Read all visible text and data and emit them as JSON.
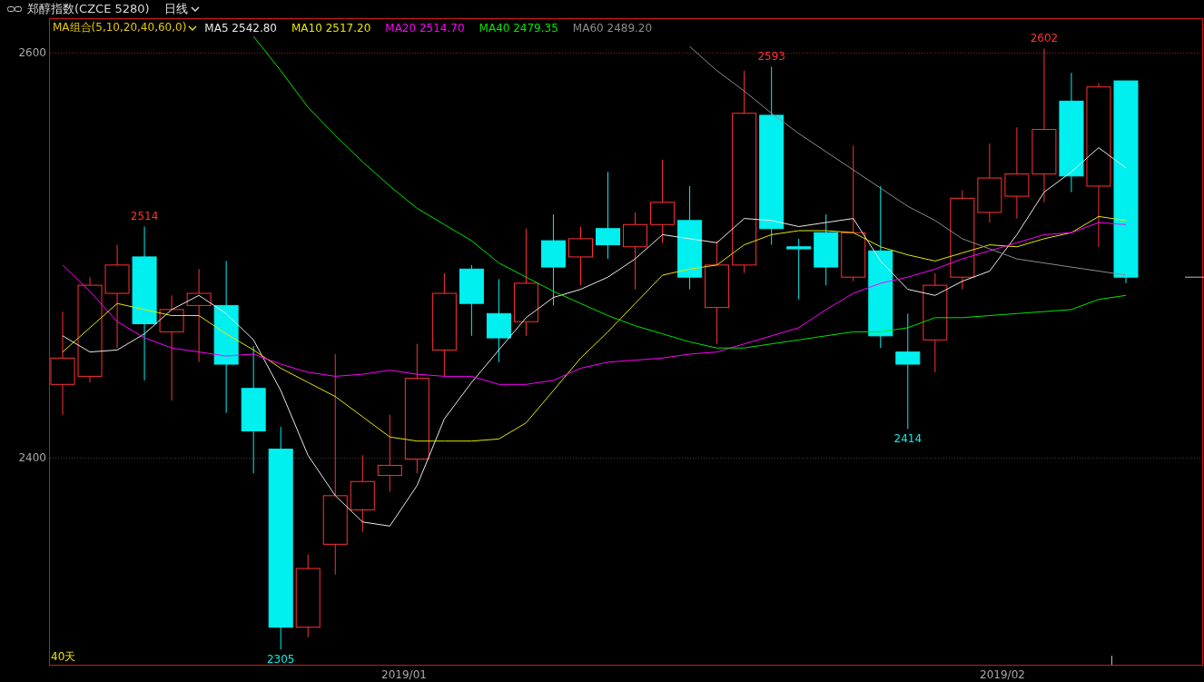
{
  "header": {
    "title": "郑醇指数(CZCE 5280)",
    "period": "日线"
  },
  "indicator_bar": {
    "preset": "MA组合(5,10,20,40,60,0)",
    "values": [
      "2542.80",
      "2517.20",
      "2514.70",
      "2479.35",
      "2489.20"
    ]
  },
  "period_label": "40天",
  "price_labels": [
    {
      "text": "2514",
      "kind": "high"
    },
    {
      "text": "2305",
      "kind": "low"
    },
    {
      "text": "2593",
      "kind": "high"
    },
    {
      "text": "2414",
      "kind": "low"
    },
    {
      "text": "2602",
      "kind": "high"
    }
  ],
  "x_axis_labels": [
    "2019/01",
    "2019/02"
  ],
  "chart": {
    "chart_data": {
      "type": "candlestick",
      "ylim": [
        2297,
        2617
      ],
      "yticks": [
        2400,
        2600
      ],
      "ref_lines": [
        {
          "axis": "y",
          "value": 2600,
          "color": "#b01010"
        },
        {
          "axis": "y",
          "value": 2400,
          "color": "#3a3a3a"
        }
      ],
      "ohlc": [
        [
          2436,
          2472,
          2421,
          2449
        ],
        [
          2440,
          2489,
          2437,
          2485
        ],
        [
          2481,
          2505,
          2454,
          2495
        ],
        [
          2499,
          2514,
          2438,
          2466
        ],
        [
          2462,
          2480,
          2428,
          2473
        ],
        [
          2475,
          2493,
          2447,
          2481
        ],
        [
          2475,
          2497,
          2422,
          2446
        ],
        [
          2434,
          2455,
          2392,
          2413
        ],
        [
          2404,
          2415,
          2305,
          2316
        ],
        [
          2316,
          2352,
          2311,
          2345
        ],
        [
          2357,
          2451,
          2342,
          2381
        ],
        [
          2374,
          2401,
          2363,
          2388
        ],
        [
          2391,
          2421,
          2383,
          2396
        ],
        [
          2399,
          2456,
          2392,
          2439
        ],
        [
          2453,
          2491,
          2440,
          2481
        ],
        [
          2493,
          2495,
          2460,
          2476
        ],
        [
          2471,
          2488,
          2447,
          2459
        ],
        [
          2467,
          2513,
          2460,
          2486
        ],
        [
          2507,
          2520,
          2475,
          2494
        ],
        [
          2499,
          2514,
          2485,
          2508
        ],
        [
          2513,
          2541,
          2498,
          2505
        ],
        [
          2504,
          2521,
          2483,
          2515
        ],
        [
          2515,
          2547,
          2506,
          2526
        ],
        [
          2517,
          2534,
          2483,
          2489
        ],
        [
          2474,
          2507,
          2456,
          2495
        ],
        [
          2495,
          2591,
          2491,
          2570
        ],
        [
          2569,
          2593,
          2505,
          2513
        ],
        [
          2504,
          2508,
          2478,
          2503
        ],
        [
          2511,
          2520,
          2485,
          2494
        ],
        [
          2489,
          2554,
          2487,
          2511
        ],
        [
          2502,
          2534,
          2454,
          2460
        ],
        [
          2452,
          2471,
          2414,
          2446
        ],
        [
          2458,
          2491,
          2442,
          2485
        ],
        [
          2489,
          2532,
          2483,
          2528
        ],
        [
          2521,
          2555,
          2516,
          2538
        ],
        [
          2529,
          2563,
          2518,
          2540
        ],
        [
          2540,
          2602,
          2526,
          2562
        ],
        [
          2576,
          2590,
          2531,
          2539
        ],
        [
          2534,
          2585,
          2504,
          2583
        ],
        [
          2586,
          2586,
          2486,
          2489
        ]
      ]
    }
  },
  "moving_averages": {
    "chart_data": {
      "type": "line",
      "ylim": [
        2297,
        2617
      ],
      "series": [
        {
          "name": "MA5",
          "color": "#e8e8e8",
          "values": [
            2460,
            2452,
            2453,
            2461,
            2473,
            2480,
            2471,
            2458,
            2433,
            2401,
            2381,
            2368,
            2366,
            2386,
            2419,
            2437,
            2453,
            2469,
            2479,
            2483,
            2489,
            2498,
            2510,
            2508,
            2506,
            2518,
            2517,
            2514,
            2516,
            2518,
            2497,
            2483,
            2480,
            2487,
            2492,
            2510,
            2531,
            2541,
            2553,
            2543
          ]
        },
        {
          "name": "MA10",
          "color": "#e6e600",
          "values": [
            2452,
            2464,
            2476,
            2473,
            2470,
            2470,
            2461,
            2453,
            2444,
            2437,
            2430,
            2420,
            2410,
            2408,
            2408,
            2408,
            2409,
            2417,
            2433,
            2449,
            2462,
            2476,
            2490,
            2493,
            2495,
            2505,
            2510,
            2512,
            2512,
            2511,
            2504,
            2500,
            2497,
            2501,
            2505,
            2504,
            2508,
            2511,
            2519,
            2517
          ]
        },
        {
          "name": "MA20",
          "color": "#ff00ff",
          "values": [
            2495,
            2482,
            2467,
            2459,
            2454,
            2452,
            2450,
            2451,
            2446,
            2442,
            2440,
            2441,
            2443,
            2441,
            2440,
            2440,
            2436,
            2436,
            2438,
            2444,
            2447,
            2448,
            2449,
            2451,
            2452,
            2456,
            2460,
            2464,
            2473,
            2481,
            2486,
            2489,
            2493,
            2498,
            2502,
            2506,
            2510,
            2511,
            2516,
            2515
          ]
        },
        {
          "name": "MA40",
          "color": "#00e600",
          "values": [
            null,
            null,
            null,
            null,
            null,
            null,
            null,
            2608,
            2591,
            2573,
            2559,
            2546,
            2534,
            2523,
            2515,
            2507,
            2496,
            2489,
            2482,
            2476,
            2470,
            2465,
            2461,
            2457,
            2454,
            2454,
            2456,
            2458,
            2460,
            2462,
            2462,
            2464,
            2469,
            2469,
            2470,
            2471,
            2472,
            2473,
            2478,
            2480
          ]
        },
        {
          "name": "MA60",
          "color": "#8c8c8c",
          "values": [
            null,
            null,
            null,
            null,
            null,
            null,
            null,
            null,
            null,
            null,
            null,
            null,
            null,
            null,
            null,
            null,
            null,
            null,
            null,
            null,
            null,
            null,
            null,
            2603,
            2591,
            2581,
            2570,
            2560,
            2551,
            2542,
            2533,
            2524,
            2517,
            2508,
            2503,
            2498,
            2496,
            2494,
            2492,
            2490
          ]
        }
      ]
    }
  }
}
